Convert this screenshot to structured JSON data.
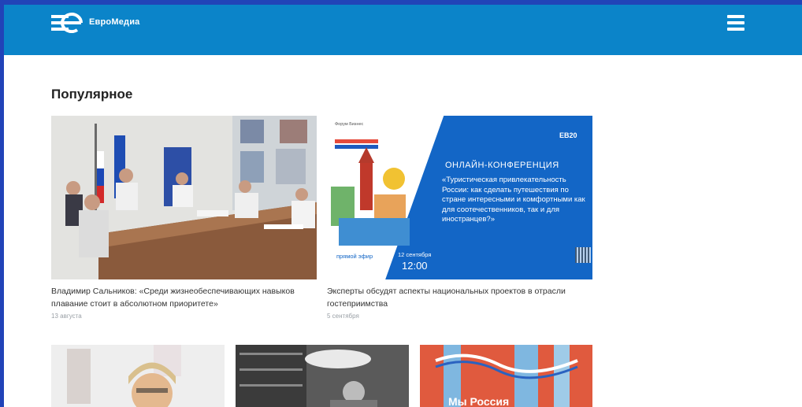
{
  "header": {
    "logo_text": "ЕвроМедиа",
    "menu_icon": "hamburger-menu-icon"
  },
  "section": {
    "title": "Популярное"
  },
  "articles": [
    {
      "caption": "Владимир Сальников: «Среди жизнеобеспечивающих навыков плавание стоит в абсолютном приоритете»",
      "date": "13 августа"
    },
    {
      "caption": "Эксперты обсудят аспекты национальных проектов в отрасли гостеприимства",
      "date": "5 сентября"
    }
  ],
  "conference": {
    "badge": "Форум Бизнес",
    "logo": "EB20",
    "heading": "ОНЛАЙН-КОНФЕРЕНЦИЯ",
    "text": "«Туристическая привлекательность России: как сделать путешествия по стране интересными и комфортными как для соотечественников, так и для иностранцев?»",
    "live": "прямой эфир",
    "date": "12 сентября",
    "time": "12:00"
  },
  "bottom_cards": [
    {
      "overlay": ""
    },
    {
      "overlay": ""
    },
    {
      "overlay": "Мы Россия"
    }
  ],
  "colors": {
    "page_border": "#2143b8",
    "header_bg": "#0b84c9",
    "conference_blue": "#1366c6"
  }
}
